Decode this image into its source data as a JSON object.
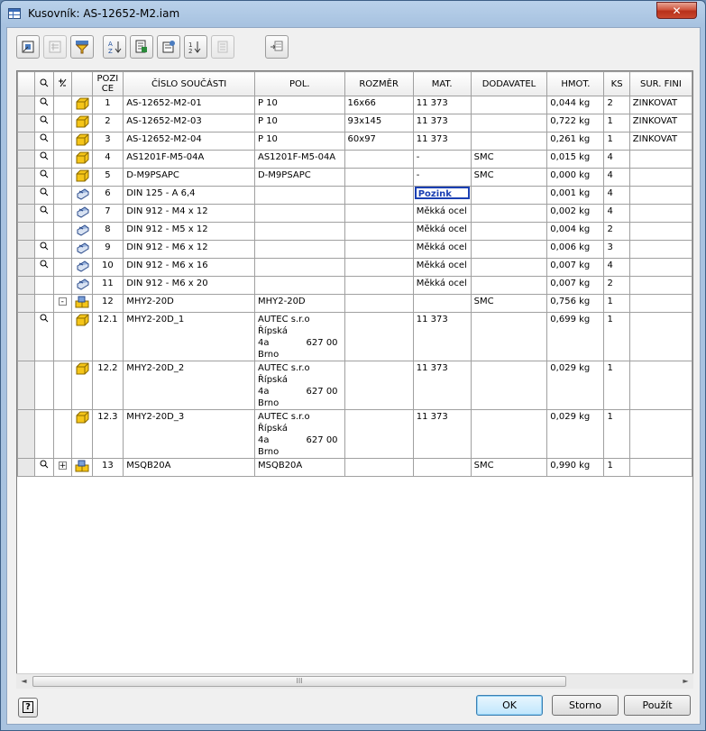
{
  "window": {
    "title": "Kusovník: AS-12652-M2.iam",
    "close_glyph": "✕"
  },
  "toolbar": {
    "buttons": [
      "place-view-icon",
      "bom-structure-icon",
      "filter-icon",
      "sort-icon",
      "export-icon",
      "settings-icon",
      "renumber-icon",
      "merge-icon",
      "zoom-icon"
    ]
  },
  "table": {
    "headers": {
      "view": "",
      "expand": "",
      "poz_1": "POZI",
      "poz_2": "CE",
      "cislo": "ČÍSLO SOUČÁSTI",
      "pol": "POL.",
      "rozmer": "ROZMĚR",
      "mat": "MAT.",
      "dodavatel": "DODAVATEL",
      "hmot": "HMOT.",
      "ks": "KS",
      "sur": "SUR. FINI"
    },
    "rows": [
      {
        "view": true,
        "tree": "",
        "icon": "part",
        "poz": "1",
        "cislo": "AS-12652-M2-01",
        "pol": "P 10",
        "pol2": "",
        "pol3": "",
        "rozmer": "16x66",
        "mat": "11 373",
        "dod": "",
        "hmot": "0,044 kg",
        "ks": "2",
        "sur": "ZINKOVAT"
      },
      {
        "view": true,
        "tree": "",
        "icon": "part",
        "poz": "2",
        "cislo": "AS-12652-M2-03",
        "pol": "P 10",
        "pol2": "",
        "pol3": "",
        "rozmer": "93x145",
        "mat": "11 373",
        "dod": "",
        "hmot": "0,722 kg",
        "ks": "1",
        "sur": "ZINKOVAT"
      },
      {
        "view": true,
        "tree": "",
        "icon": "part",
        "poz": "3",
        "cislo": "AS-12652-M2-04",
        "pol": "P 10",
        "pol2": "",
        "pol3": "",
        "rozmer": "60x97",
        "mat": "11 373",
        "dod": "",
        "hmot": "0,261 kg",
        "ks": "1",
        "sur": "ZINKOVAT"
      },
      {
        "view": true,
        "tree": "",
        "icon": "part",
        "poz": "4",
        "cislo": "AS1201F-M5-04A",
        "pol": "AS1201F-M5-04A",
        "pol2": "",
        "pol3": "",
        "rozmer": "",
        "mat": "-",
        "dod": "SMC",
        "hmot": "0,015 kg",
        "ks": "4",
        "sur": ""
      },
      {
        "view": true,
        "tree": "",
        "icon": "part",
        "poz": "5",
        "cislo": "D-M9PSAPC",
        "pol": "D-M9PSAPC",
        "pol2": "",
        "pol3": "",
        "rozmer": "",
        "mat": "-",
        "dod": "SMC",
        "hmot": "0,000 kg",
        "ks": "4",
        "sur": ""
      },
      {
        "view": true,
        "tree": "",
        "icon": "cc",
        "poz": "6",
        "cislo": "DIN 125 - A 6,4",
        "pol": "",
        "pol2": "",
        "pol3": "",
        "rozmer": "",
        "mat": "Pozink",
        "dod": "",
        "hmot": "0,001 kg",
        "ks": "4",
        "sur": "",
        "editing": true
      },
      {
        "view": true,
        "tree": "",
        "icon": "cc",
        "poz": "7",
        "cislo": "DIN 912 - M4 x 12",
        "pol": "",
        "pol2": "",
        "pol3": "",
        "rozmer": "",
        "mat": "Měkká ocel",
        "dod": "",
        "hmot": "0,002 kg",
        "ks": "4",
        "sur": ""
      },
      {
        "view": false,
        "tree": "",
        "icon": "cc",
        "poz": "8",
        "cislo": "DIN 912 - M5 x 12",
        "pol": "",
        "pol2": "",
        "pol3": "",
        "rozmer": "",
        "mat": "Měkká ocel",
        "dod": "",
        "hmot": "0,004 kg",
        "ks": "2",
        "sur": ""
      },
      {
        "view": true,
        "tree": "",
        "icon": "cc",
        "poz": "9",
        "cislo": "DIN 912 - M6 x 12",
        "pol": "",
        "pol2": "",
        "pol3": "",
        "rozmer": "",
        "mat": "Měkká ocel",
        "dod": "",
        "hmot": "0,006 kg",
        "ks": "3",
        "sur": ""
      },
      {
        "view": true,
        "tree": "",
        "icon": "cc",
        "poz": "10",
        "cislo": "DIN 912 - M6 x 16",
        "pol": "",
        "pol2": "",
        "pol3": "",
        "rozmer": "",
        "mat": "Měkká ocel",
        "dod": "",
        "hmot": "0,007 kg",
        "ks": "4",
        "sur": ""
      },
      {
        "view": false,
        "tree": "",
        "icon": "cc",
        "poz": "11",
        "cislo": "DIN 912 - M6 x 20",
        "pol": "",
        "pol2": "",
        "pol3": "",
        "rozmer": "",
        "mat": "Měkká ocel",
        "dod": "",
        "hmot": "0,007 kg",
        "ks": "2",
        "sur": ""
      },
      {
        "view": false,
        "tree": "-",
        "icon": "asm",
        "poz": "12",
        "cislo": "MHY2-20D",
        "pol": "MHY2-20D",
        "pol2": "",
        "pol3": "",
        "rozmer": "",
        "mat": "",
        "dod": "SMC",
        "hmot": "0,756 kg",
        "ks": "1",
        "sur": ""
      },
      {
        "view": true,
        "tree": "",
        "icon": "part",
        "poz": "12.1",
        "cislo": "MHY2-20D_1",
        "pol": "AUTEC s.r.o Řípská",
        "pol2": "4a",
        "pol2b": "627 00",
        "pol3": "Brno",
        "rozmer": "",
        "mat": "11 373",
        "dod": "",
        "hmot": "0,699 kg",
        "ks": "1",
        "sur": "",
        "tall": true
      },
      {
        "view": false,
        "tree": "",
        "icon": "part",
        "poz": "12.2",
        "cislo": "MHY2-20D_2",
        "pol": "AUTEC s.r.o Řípská",
        "pol2": "4a",
        "pol2b": "627 00",
        "pol3": "Brno",
        "rozmer": "",
        "mat": "11 373",
        "dod": "",
        "hmot": "0,029 kg",
        "ks": "1",
        "sur": "",
        "tall": true
      },
      {
        "view": false,
        "tree": "",
        "icon": "part",
        "poz": "12.3",
        "cislo": "MHY2-20D_3",
        "pol": "AUTEC s.r.o Řípská",
        "pol2": "4a",
        "pol2b": "627 00",
        "pol3": "Brno",
        "rozmer": "",
        "mat": "11 373",
        "dod": "",
        "hmot": "0,029 kg",
        "ks": "1",
        "sur": "",
        "tall": true
      },
      {
        "view": true,
        "tree": "+",
        "icon": "asm",
        "poz": "13",
        "cislo": "MSQB20A",
        "pol": "MSQB20A",
        "pol2": "",
        "pol3": "",
        "rozmer": "",
        "mat": "",
        "dod": "SMC",
        "hmot": "0,990 kg",
        "ks": "1",
        "sur": ""
      }
    ]
  },
  "scrollbar": {
    "grip": "III",
    "left": "◄",
    "right": "►"
  },
  "footer": {
    "help": "?",
    "ok": "OK",
    "cancel": "Storno",
    "apply": "Použít"
  }
}
